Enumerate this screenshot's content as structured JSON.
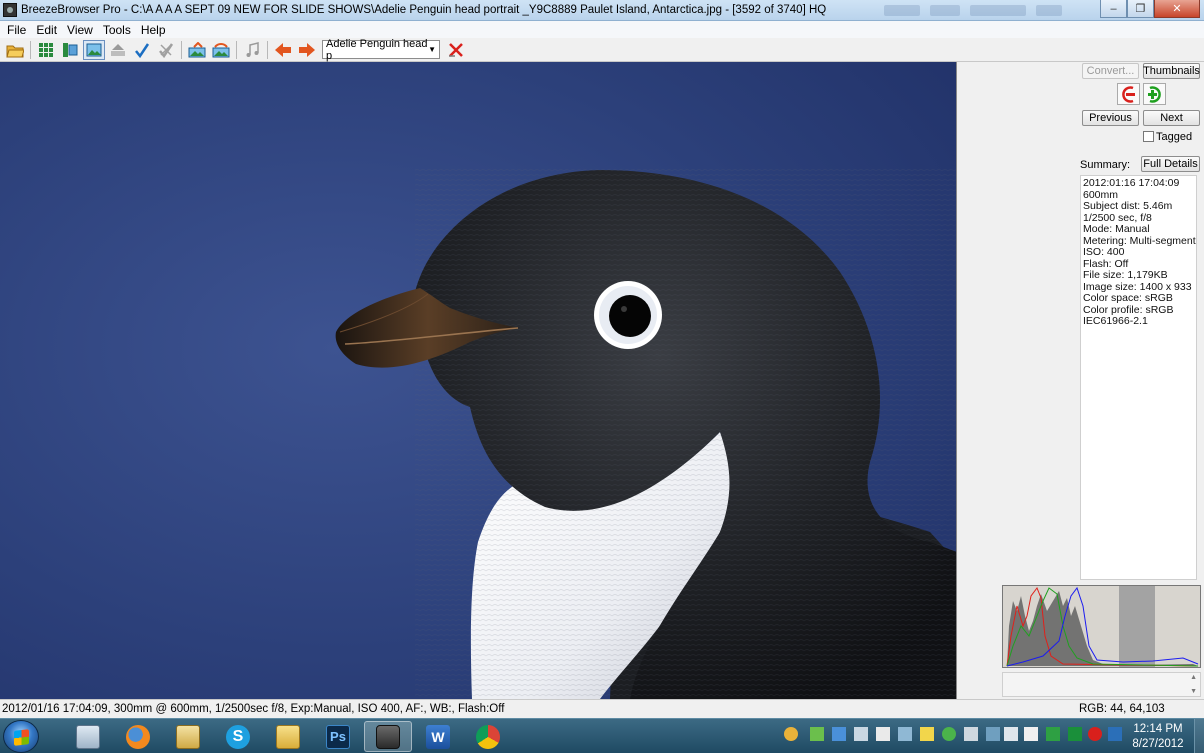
{
  "window": {
    "app_title": "BreezeBrowser Pro - C:\\A A A A SEPT 09 NEW FOR SLIDE SHOWS\\Adelie Penguin head portrait _Y9C8889  Paulet Island, Antarctica.jpg - [3592 of 3740] HQ"
  },
  "menu": {
    "items": [
      "File",
      "Edit",
      "View",
      "Tools",
      "Help"
    ]
  },
  "toolbar": {
    "combo_value": "Adelie Penguin head p",
    "icons": [
      "open-folder-icon",
      "grid-thumbnails-icon",
      "thumbnail-preview-icon",
      "single-image-icon",
      "raw-icon",
      "checkmark-icon",
      "untag-icon",
      "landscape-icon",
      "landscape-export-icon",
      "music-note-icon",
      "arrow-left-icon",
      "arrow-right-icon",
      "delete-x-icon"
    ],
    "colors": {
      "arrow": "#e2561f",
      "check": "#1b6ec2",
      "delete": "#d9201c"
    }
  },
  "panel": {
    "convert_label": "Convert...",
    "thumbnails_label": "Thumbnails",
    "previous_label": "Previous",
    "next_label": "Next",
    "tagged_label": "Tagged",
    "summary_label": "Summary:",
    "full_details_label": "Full Details",
    "details": [
      "2012:01:16 17:04:09",
      "600mm",
      "Subject dist: 5.46m",
      "1/2500 sec, f/8",
      "Mode: Manual",
      "Metering: Multi-segment",
      "ISO: 400",
      "Flash: Off",
      "File size: 1,179KB",
      "Image size: 1400 x 933",
      "Color space: sRGB",
      "Color profile: sRGB",
      "IEC61966-2.1"
    ],
    "histogram": {
      "colors": {
        "red": "#e0201a",
        "green": "#1fa01f",
        "blue": "#1c1cf0",
        "luma": "#555555"
      }
    }
  },
  "status": {
    "info": "2012/01/16 17:04:09, 300mm @ 600mm, 1/2500sec f/8, Exp:Manual, ISO 400, AF:, WB:, Flash:Off",
    "rgb": "RGB:  44, 64,103"
  },
  "taskbar": {
    "apps": [
      "calculator-icon",
      "firefox-icon",
      "mail-icon",
      "skype-icon",
      "file-explorer-icon",
      "photoshop-icon",
      "breezebrowser-icon",
      "word-icon",
      "chrome-icon"
    ],
    "photoshop_text": "Ps",
    "word_text": "W",
    "time": "12:14 PM",
    "date": "8/27/2012"
  }
}
